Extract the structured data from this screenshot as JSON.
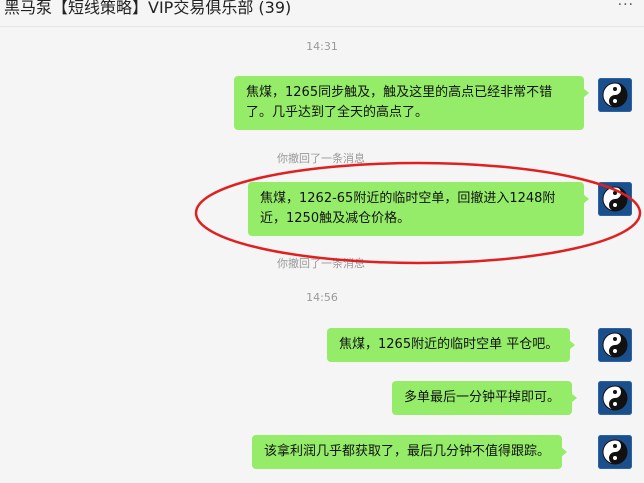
{
  "header": {
    "title": "黑马泵【短线策略】VIP交易俱乐部 (39)",
    "more_icon": "more-dots-icon",
    "more_glyph": "···"
  },
  "timestamps": [
    "14:31",
    "14:56"
  ],
  "system_notes": [
    "你撤回了一条消息",
    "你撤回了一条消息"
  ],
  "messages": [
    {
      "text": "焦煤，1265同步触及，触及这里的高点已经非常不错了。几乎达到了全天的高点了。"
    },
    {
      "text": "焦煤，1262-65附近的临时空单，回撤进入1248附近，1250触及减仓价格。"
    },
    {
      "text": "焦煤，1265附近的临时空单 平仓吧。"
    },
    {
      "text": "多单最后一分钟平掉即可。"
    },
    {
      "text": "该拿利润几乎都获取了，最后几分钟不值得跟踪。"
    }
  ],
  "avatar_icon": "yin-yang-icon",
  "colors": {
    "bubble": "#95ec69",
    "background": "#f5f5f5",
    "annotation": "#e02020",
    "avatar_bg": "#1b4f8c"
  }
}
